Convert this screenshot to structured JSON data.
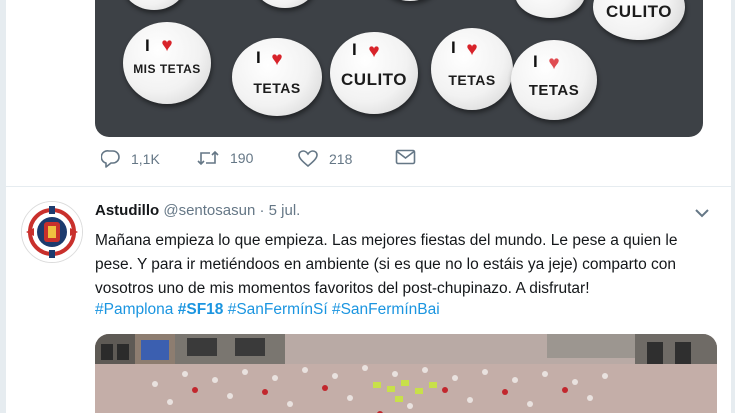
{
  "tweet1": {
    "media": {
      "pins": [
        {
          "line1": "I",
          "line2": "MIS TETAS"
        },
        {
          "line1": "I",
          "line2": "TETAS"
        },
        {
          "line1": "I",
          "line2": "CULITO"
        },
        {
          "line1": "I",
          "line2": "TETAS"
        },
        {
          "line1": "I",
          "line2": "TETAS"
        },
        {
          "line1": "",
          "line2": "CULITO"
        }
      ]
    },
    "actions": {
      "replies": "1,1K",
      "retweets": "190",
      "likes": "218"
    }
  },
  "tweet2": {
    "name": "Astudillo",
    "handle": "@sentosasun",
    "dot": "·",
    "date": "5 jul.",
    "text": "Mañana empieza lo que empieza. Las mejores fiestas del mundo. Le pese a quien le pese. Y para ir metiéndoos en ambiente (si es que no lo estáis ya jeje) comparto con vosotros uno de mis momentos favoritos del post-chupinazo. A disfrutar!",
    "hashtags": [
      "#Pamplona",
      "#SF18",
      "#SanFermínSí",
      "#SanFermínBai"
    ]
  },
  "colors": {
    "link": "#1b95e0",
    "muted": "#657786",
    "heart_red": "#d8232a"
  },
  "icons": [
    "reply-icon",
    "retweet-icon",
    "like-icon",
    "message-icon",
    "chevron-down-icon"
  ]
}
